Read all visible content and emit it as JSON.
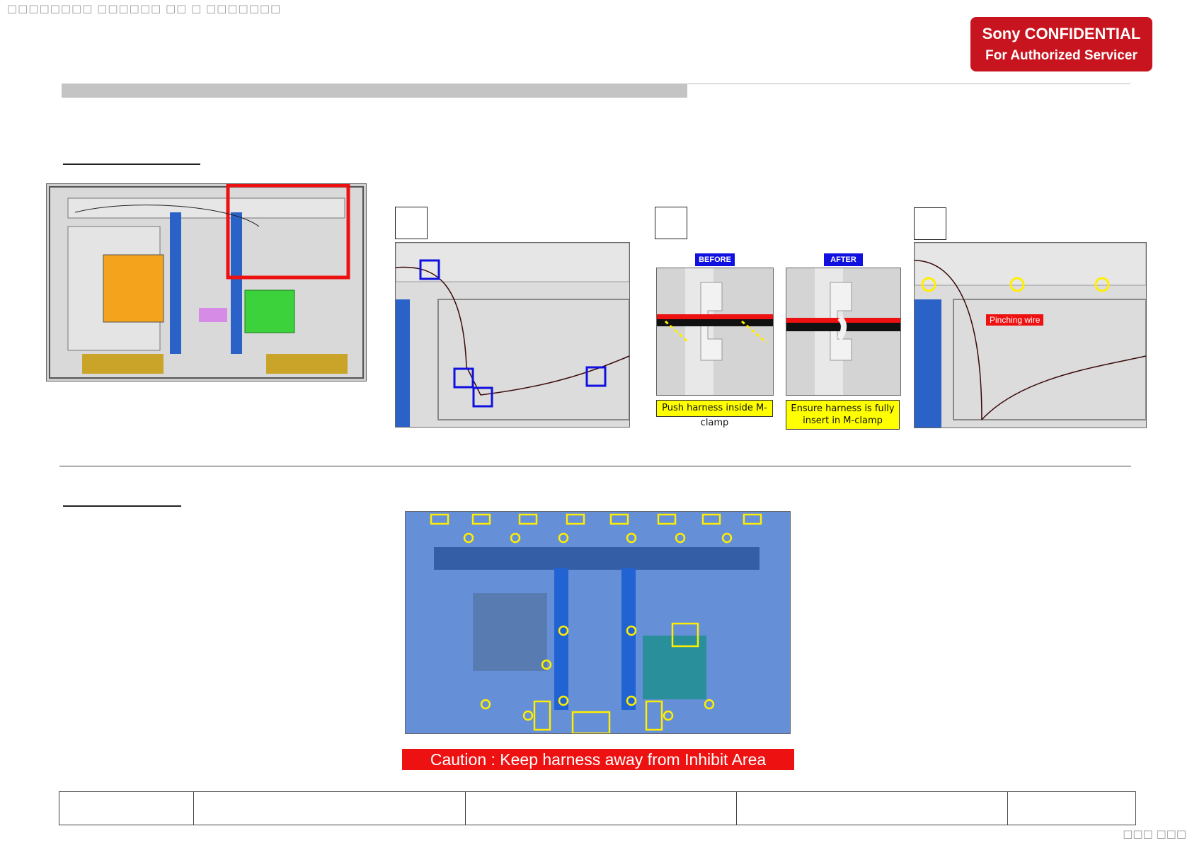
{
  "header": {
    "garbled_title": "□□□□□□□□ □□□□□□ □□ □ □□□□□□□",
    "confidential_line1": "Sony CONFIDENTIAL",
    "confidential_line2": "For Authorized Servicer"
  },
  "figures": {
    "before_tag": "BEFORE",
    "after_tag": "AFTER",
    "before_caption": "Push harness inside M-clamp",
    "after_caption": "Ensure harness is fully insert in M-clamp",
    "pinching_label": "Pinching wire",
    "caution": "Caution : Keep harness away from Inhibit Area"
  },
  "footer": {
    "page_number": "□□□ □□□"
  },
  "colors": {
    "confidential_red": "#c8141e",
    "caution_red": "#ee1111",
    "highlight_blue": "#1010e0",
    "highlight_yellow": "#ffff00",
    "inhibit_overlay": "#1e64dc"
  }
}
